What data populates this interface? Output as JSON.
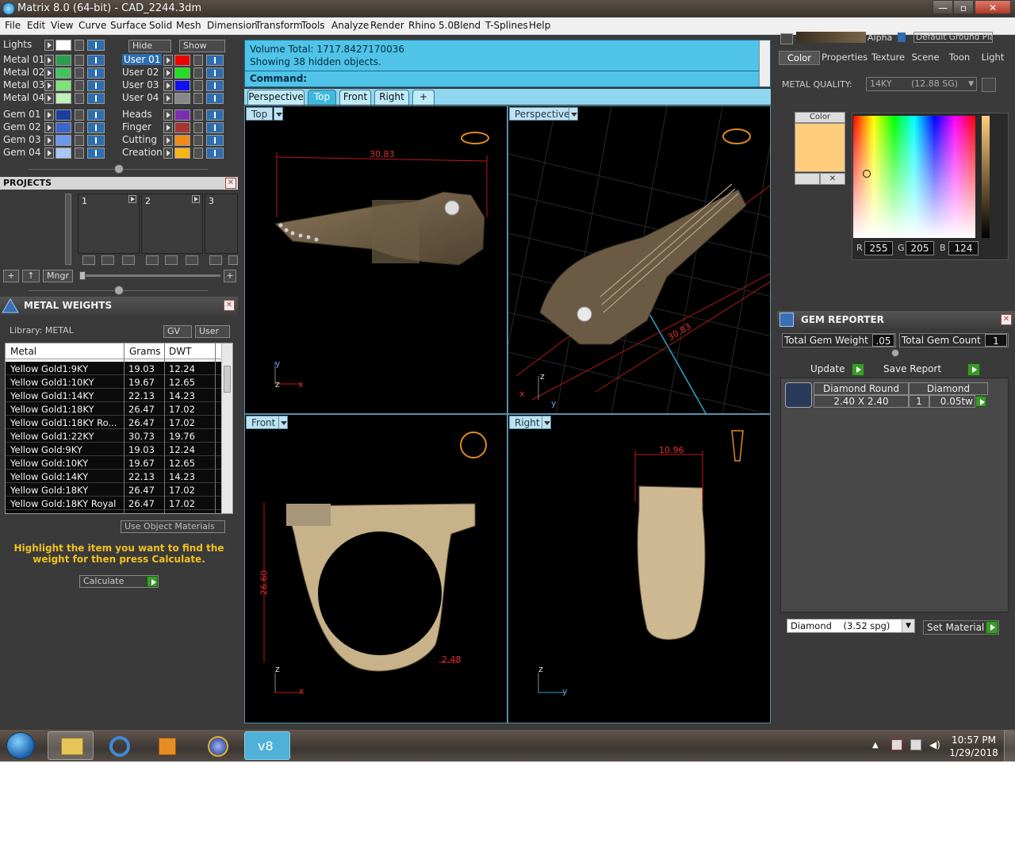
{
  "window": {
    "title": "Matrix 8.0 (64-bit) - CAD_2244.3dm",
    "min": "—",
    "max": "▫",
    "close": "✕"
  },
  "menu": [
    "File",
    "Edit",
    "View",
    "Curve",
    "Surface",
    "Solid",
    "Mesh",
    "Dimension",
    "Transform",
    "Tools",
    "Analyze",
    "Render",
    "Rhino 5.0",
    "Blend",
    "T-Splines",
    "Help"
  ],
  "layers": {
    "lights_label": "Lights",
    "hide_label": "Hide",
    "show_label": "Show",
    "left": [
      {
        "name": "Metal 01",
        "color": "#2e9e4e"
      },
      {
        "name": "Metal 02",
        "color": "#47c062"
      },
      {
        "name": "Metal 03",
        "color": "#7ee27a"
      },
      {
        "name": "Metal 04",
        "color": "#bff0b5"
      },
      {
        "name": "Gem 01",
        "color": "#1c3e9e"
      },
      {
        "name": "Gem 02",
        "color": "#3d66cc"
      },
      {
        "name": "Gem 03",
        "color": "#6d97ee"
      },
      {
        "name": "Gem 04",
        "color": "#a9c7f5"
      }
    ],
    "right": [
      {
        "name": "User 01",
        "color": "#ee0000",
        "selected": true
      },
      {
        "name": "User 02",
        "color": "#22dd22"
      },
      {
        "name": "User 03",
        "color": "#1111ee"
      },
      {
        "name": "User 04",
        "color": "#888888"
      },
      {
        "name": "Heads",
        "color": "#7a2fb0"
      },
      {
        "name": "Finger",
        "color": "#a63636"
      },
      {
        "name": "Cutting",
        "color": "#f08a1a"
      },
      {
        "name": "Creation",
        "color": "#f7b61c"
      }
    ]
  },
  "projects": {
    "title": "PROJECTS",
    "slots": [
      "1",
      "2",
      "3"
    ],
    "mngr_label": "Mngr",
    "add": "+",
    "up": "↑"
  },
  "metal_weights": {
    "title": "METAL WEIGHTS",
    "library_label": "Library: METAL",
    "gv_label": "GV",
    "user_label": "User",
    "columns": [
      "Metal",
      "Grams",
      "DWT"
    ],
    "rows": [
      [
        "Yellow Gold1:9KY",
        "19.03",
        "12.24"
      ],
      [
        "Yellow Gold1:10KY",
        "19.67",
        "12.65"
      ],
      [
        "Yellow Gold1:14KY",
        "22.13",
        "14.23"
      ],
      [
        "Yellow Gold1:18KY",
        "26.47",
        "17.02"
      ],
      [
        "Yellow Gold1:18KY Ro...",
        "26.47",
        "17.02"
      ],
      [
        "Yellow Gold1:22KY",
        "30.73",
        "19.76"
      ],
      [
        "Yellow Gold:9KY",
        "19.03",
        "12.24"
      ],
      [
        "Yellow Gold:10KY",
        "19.67",
        "12.65"
      ],
      [
        "Yellow Gold:14KY",
        "22.13",
        "14.23"
      ],
      [
        "Yellow Gold:18KY",
        "26.47",
        "17.02"
      ],
      [
        "Yellow Gold:18KY Royal",
        "26.47",
        "17.02"
      ]
    ],
    "use_object_materials": "Use Object Materials",
    "hint": "Highlight the item you want to find the weight for then press Calculate.",
    "calculate_label": "Calculate"
  },
  "command": {
    "line1": "Volume Total: 1717.8427170036",
    "line2": "Showing 38 hidden objects.",
    "prompt": "Command:"
  },
  "view_tabs": {
    "items": [
      "Perspective",
      "Top",
      "Front",
      "Right"
    ],
    "active": "Top",
    "add": "+"
  },
  "viewports": {
    "top": {
      "label": "Top",
      "dimension": "30.83",
      "axis_y": "y",
      "axis_x": "x",
      "axis_z": "z"
    },
    "perspective": {
      "label": "Perspective",
      "dimension": "30.83",
      "axis_x": "x",
      "axis_y": "y",
      "axis_z": "z"
    },
    "front": {
      "label": "Front",
      "dim_height": "26.60",
      "dim_width": "2.48",
      "axis_z": "z",
      "axis_x": "x"
    },
    "right": {
      "label": "Right",
      "dimension": "10.96",
      "axis_z": "z",
      "axis_y": "y"
    }
  },
  "right_panel": {
    "alpha_label": "Alpha",
    "ground_plane": "Default Ground Plane",
    "tabs": [
      "Color",
      "Properties",
      "Texture",
      "Scene",
      "Toon",
      "Light"
    ],
    "active_tab": "Color",
    "metal_quality_label": "METAL QUALITY:",
    "metal_quality_value": "14KY",
    "metal_quality_sg": "(12.88 SG)",
    "color_label": "Color",
    "swatch_color": "#ffcd7c",
    "rgb": {
      "r_label": "R",
      "r": "255",
      "g_label": "G",
      "g": "205",
      "b_label": "B",
      "b": "124"
    }
  },
  "gem_reporter": {
    "title": "GEM REPORTER",
    "total_weight_label": "Total Gem Weight",
    "total_weight": ".05",
    "total_count_label": "Total Gem Count",
    "total_count": "1",
    "update_label": "Update",
    "save_report_label": "Save Report",
    "gem_type": "Diamond Round",
    "gem_material": "Diamond",
    "gem_size": "2.40 X 2.40",
    "gem_qty": "1",
    "gem_weight": "0.05tw",
    "material_select": "Diamond    (3.52 spg)",
    "set_material_label": "Set Material"
  },
  "taskbar": {
    "items": [
      "windows-start",
      "file-explorer",
      "internet-explorer",
      "media-player",
      "matrix-app",
      "v8-app"
    ],
    "v8_label": "v8",
    "time": "10:57 PM",
    "date": "1/29/2018"
  }
}
